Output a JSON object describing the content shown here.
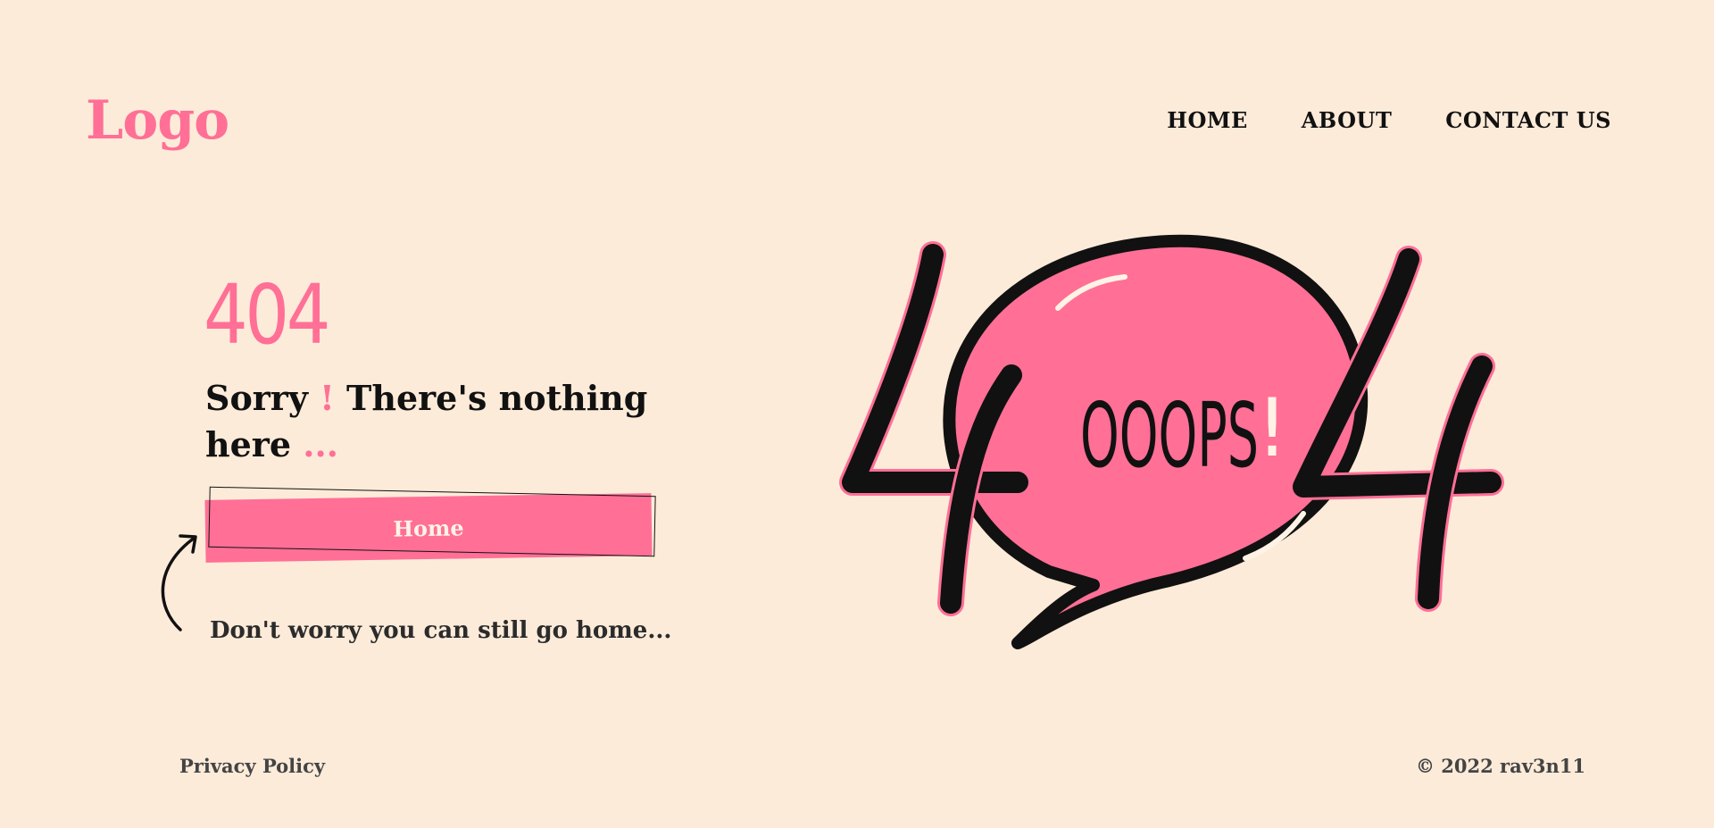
{
  "header": {
    "logo": "Logo",
    "nav": [
      {
        "label": "HOME"
      },
      {
        "label": "ABOUT"
      },
      {
        "label": "CONTACT US"
      }
    ]
  },
  "main": {
    "code": "404",
    "message_part1": "Sorry ",
    "message_exclaim": "!",
    "message_part2": " There's nothing here ",
    "message_dots": "...",
    "home_button": "Home",
    "hint": "Don't worry you can still go home..."
  },
  "illustration": {
    "left_digit": "4",
    "right_digit": "4",
    "bubble_text": "OOOPS",
    "bubble_exclaim": "!"
  },
  "footer": {
    "privacy": "Privacy Policy",
    "copyright": "© 2022 rav3n11"
  },
  "colors": {
    "background": "#fdebd9",
    "accent": "#ff6f96",
    "text": "#111111"
  }
}
